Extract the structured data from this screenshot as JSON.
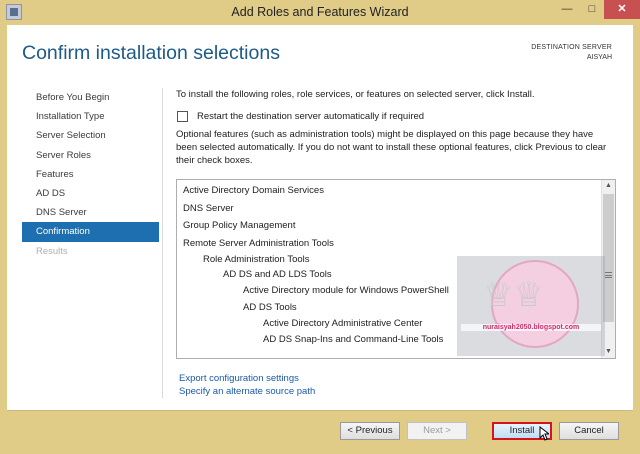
{
  "window": {
    "title": "Add Roles and Features Wizard",
    "minimize_icon": "minimize-icon",
    "maximize_icon": "maximize-icon",
    "close_icon": "close-icon"
  },
  "header": {
    "title": "Confirm installation selections",
    "destination_label": "DESTINATION SERVER",
    "destination_server": "AISYAH"
  },
  "nav": {
    "items": [
      {
        "label": "Before You Begin",
        "state": "normal"
      },
      {
        "label": "Installation Type",
        "state": "normal"
      },
      {
        "label": "Server Selection",
        "state": "normal"
      },
      {
        "label": "Server Roles",
        "state": "normal"
      },
      {
        "label": "Features",
        "state": "normal"
      },
      {
        "label": "AD DS",
        "state": "normal"
      },
      {
        "label": "DNS Server",
        "state": "normal"
      },
      {
        "label": "Confirmation",
        "state": "active"
      },
      {
        "label": "Results",
        "state": "disabled"
      }
    ]
  },
  "main": {
    "intro": "To install the following roles, role services, or features on selected server, click Install.",
    "restart_label": "Restart the destination server automatically if required",
    "restart_checked": false,
    "optional_text": "Optional features (such as administration tools) might be displayed on this page because they have been selected automatically. If you do not want to install these optional features, click Previous to clear their check boxes.",
    "selections": [
      {
        "label": "Active Directory Domain Services",
        "level": 0
      },
      {
        "label": "DNS Server",
        "level": 0
      },
      {
        "label": "Group Policy Management",
        "level": 0
      },
      {
        "label": "Remote Server Administration Tools",
        "level": 0
      },
      {
        "label": "Role Administration Tools",
        "level": 1
      },
      {
        "label": "AD DS and AD LDS Tools",
        "level": 2
      },
      {
        "label": "Active Directory module for Windows PowerShell",
        "level": 3
      },
      {
        "label": "AD DS Tools",
        "level": 3
      },
      {
        "label": "Active Directory Administrative Center",
        "level": 4
      },
      {
        "label": "AD DS Snap-Ins and Command-Line Tools",
        "level": 4
      }
    ],
    "export_link": "Export configuration settings",
    "source_link": "Specify an alternate source path"
  },
  "watermark": {
    "text": "nuraisyah2050.blogspot.com"
  },
  "footer": {
    "previous_label": "< Previous",
    "next_label": "Next >",
    "install_label": "Install",
    "cancel_label": "Cancel"
  }
}
